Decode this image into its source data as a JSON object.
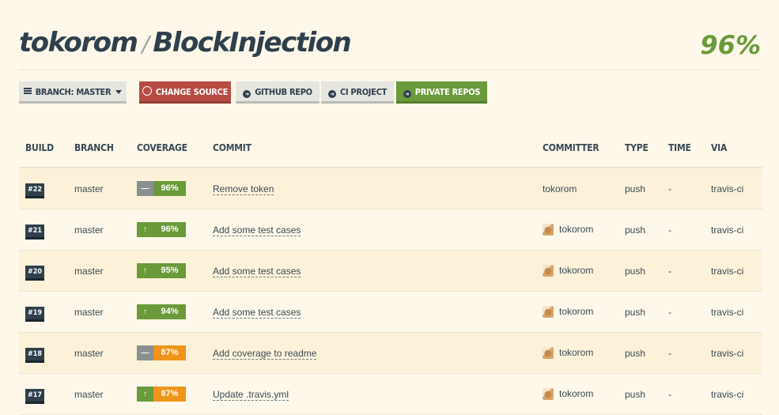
{
  "header": {
    "owner": "tokorom",
    "separator": "/",
    "repo": "BlockInjection",
    "coverage": "96%"
  },
  "toolbar": {
    "branch": "BRANCH: MASTER",
    "change_source": "CHANGE SOURCE",
    "github_repo": "GITHUB REPO",
    "ci_project": "CI PROJECT",
    "private_repos": "PRIVATE REPOS"
  },
  "table": {
    "columns": [
      "BUILD",
      "BRANCH",
      "COVERAGE",
      "COMMIT",
      "COMMITTER",
      "TYPE",
      "TIME",
      "VIA"
    ],
    "rows": [
      {
        "build": "#22",
        "branch": "master",
        "trend": "same",
        "coverage": "96%",
        "coverage_color": "#6a9a3a",
        "commit": "Remove token",
        "committer": "tokorom",
        "avatar": false,
        "type": "push",
        "time": "-",
        "via": "travis-ci"
      },
      {
        "build": "#21",
        "branch": "master",
        "trend": "up",
        "coverage": "96%",
        "coverage_color": "#6a9a3a",
        "commit": "Add some test cases",
        "committer": "tokorom",
        "avatar": true,
        "type": "push",
        "time": "-",
        "via": "travis-ci"
      },
      {
        "build": "#20",
        "branch": "master",
        "trend": "up",
        "coverage": "95%",
        "coverage_color": "#6a9a3a",
        "commit": "Add some test cases",
        "committer": "tokorom",
        "avatar": true,
        "type": "push",
        "time": "-",
        "via": "travis-ci"
      },
      {
        "build": "#19",
        "branch": "master",
        "trend": "up",
        "coverage": "94%",
        "coverage_color": "#6a9a3a",
        "commit": "Add some test cases",
        "committer": "tokorom",
        "avatar": true,
        "type": "push",
        "time": "-",
        "via": "travis-ci"
      },
      {
        "build": "#18",
        "branch": "master",
        "trend": "same",
        "coverage": "87%",
        "coverage_color": "#f0941a",
        "commit": "Add coverage to readme",
        "committer": "tokorom",
        "avatar": true,
        "type": "push",
        "time": "-",
        "via": "travis-ci"
      },
      {
        "build": "#17",
        "branch": "master",
        "trend": "up",
        "coverage": "87%",
        "coverage_color": "#f0941a",
        "commit": "Update .travis.yml",
        "committer": "tokorom",
        "avatar": true,
        "type": "push",
        "time": "-",
        "via": "travis-ci"
      }
    ]
  }
}
